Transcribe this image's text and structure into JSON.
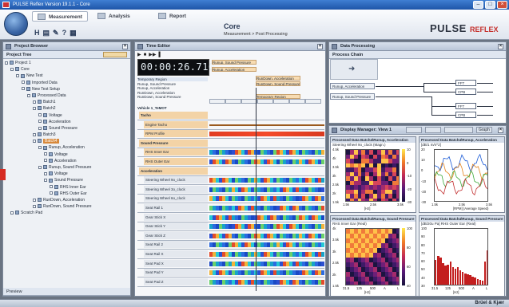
{
  "window": {
    "title": "PULSE Reflex Version 19.1.1 - Core"
  },
  "ribbon": {
    "tabs": [
      {
        "label": "Measurement",
        "active": true
      },
      {
        "label": "Analysis",
        "active": false
      },
      {
        "label": "Report",
        "active": false
      }
    ],
    "quick_access": [
      "H",
      "▤",
      "✎",
      "?",
      "▦"
    ],
    "page_title": "Core",
    "breadcrumb": "Measurement > Post Processing",
    "brand": "PULSE",
    "brand_sub": "REFLEX"
  },
  "project_browser": {
    "title": "Project Browser",
    "subtitle": "Project Tree",
    "tree": [
      {
        "label": "Project 1",
        "level": 0,
        "icon": "project-icon"
      },
      {
        "label": "Core",
        "level": 1,
        "icon": "folder-icon"
      },
      {
        "label": "New Test",
        "level": 2,
        "icon": "test-icon"
      },
      {
        "label": "Imported Data",
        "level": 3,
        "icon": "data-icon"
      },
      {
        "label": "New Test Setup",
        "level": 3,
        "icon": "setup-icon"
      },
      {
        "label": "Processed Data",
        "level": 4,
        "icon": "data-icon"
      },
      {
        "label": "Batch1",
        "level": 5,
        "icon": "batch-icon"
      },
      {
        "label": "Batch2",
        "level": 5,
        "icon": "batch-icon"
      },
      {
        "label": "Voltage",
        "level": 6,
        "icon": "signal-icon"
      },
      {
        "label": "Acceleration",
        "level": 6,
        "icon": "signal-icon"
      },
      {
        "label": "Sound Pressure",
        "level": 6,
        "icon": "signal-icon"
      },
      {
        "label": "Batch3",
        "level": 5,
        "icon": "batch-icon"
      },
      {
        "label": "Batch4",
        "level": 5,
        "icon": "batch-icon",
        "highlighted": true
      },
      {
        "label": "Runup, Acceleration",
        "level": 6,
        "icon": "signal-icon"
      },
      {
        "label": "Voltage",
        "level": 7,
        "icon": "signal-icon"
      },
      {
        "label": "Acceleration",
        "level": 7,
        "icon": "signal-icon"
      },
      {
        "label": "Runup, Sound Pressure",
        "level": 6,
        "icon": "signal-icon"
      },
      {
        "label": "Voltage",
        "level": 7,
        "icon": "signal-icon"
      },
      {
        "label": "Sound Pressure",
        "level": 7,
        "icon": "signal-icon"
      },
      {
        "label": "RHS Inner Ear",
        "level": 8,
        "icon": "signal-icon"
      },
      {
        "label": "RHS Outer Ear",
        "level": 8,
        "icon": "signal-icon"
      },
      {
        "label": "RunDown, Acceleration",
        "level": 5,
        "icon": "signal-icon"
      },
      {
        "label": "RunDown, Sound Pressure",
        "level": 5,
        "icon": "signal-icon"
      },
      {
        "label": "Scratch Pad",
        "level": 1,
        "icon": "pad-icon"
      }
    ],
    "preview_label": "Preview"
  },
  "time_editor": {
    "title": "Time Editor",
    "timer": "00:00:26.710",
    "recordings": [
      "Temporary Region",
      "Runup, Sound Pressure",
      "Runup, Acceleration",
      "RunDown, Acceleration",
      "RunDown, Sound Pressure"
    ],
    "tags": [
      "Runup, Sound Pressure",
      "Runup, Acceleration",
      "RunDown, Acceleration",
      "RunDown, Sound Pressure",
      "Temporary Region"
    ],
    "recording_name": "Vehicle 1_TeMOT",
    "channels": [
      "Tacho",
      "Engine Tacho",
      "RPM Profile",
      "Sound Pressure",
      "RHS Inner Ear",
      "RHS Outer Ear",
      "Acceleration",
      "Steering Wheel 9o_clock",
      "Steering Wheel 3o_clock",
      "Steering Wheel 6o_clock",
      "Seat Rail 1",
      "Gear Stick X",
      "Gear Stick Y",
      "Gear Stick Z",
      "Seat Rail 2",
      "Seat Rail X",
      "Seat Pad X",
      "Seat Pad Y",
      "Seat Pad Z"
    ]
  },
  "data_processing": {
    "title": "Data Processing",
    "process_chain_label": "Process Chain",
    "inputs": [
      "Runup, Acceleration",
      "Runup, Sound Pressure"
    ],
    "nodes": [
      "FFT",
      "CPB",
      "FFT",
      "CPB"
    ]
  },
  "display_manager": {
    "title": "Display Manager: View 1",
    "graph_btn": "Graph",
    "charts": [
      {
        "title": "Processed Data Batch4\\Runup, Acceleration",
        "subtitle": "Steering Wheel 9o_clock (Magn.)",
        "yunit": "[dB/1 m/s^2]",
        "x_label": "[Hz]",
        "x_ticks": [
          "1.5k",
          "2.5k",
          "3.5k"
        ]
      },
      {
        "title": "Processed Data Batch4\\Runup, Acceleration",
        "subtitle": "[dB/1 m/s^2]",
        "yunit": "",
        "x_label": "[RPM] (Average Speed)",
        "x_ticks": [
          "1.5k",
          "2.5k",
          "3.5k"
        ]
      },
      {
        "title": "Processed Data Batch4\\Runup, Sound Pressure",
        "subtitle": "RHS Inner Ear (Real)",
        "yunit": "[dB/20u Pa]",
        "x_label": "[Hz]",
        "x_ticks": [
          "31.5",
          "125",
          "500",
          "A",
          "L"
        ]
      },
      {
        "title": "Processed Data Batch4\\Runup, Sound Pressure",
        "subtitle": "[dB/20u Pa] RHS Outer Ear (Real)",
        "yunit": "",
        "x_label": "[Hz]",
        "x_ticks": [
          "31.5",
          "125",
          "500",
          "A",
          "L"
        ]
      }
    ]
  },
  "status_bar": {
    "company": "Brüel & Kjær"
  },
  "chart_data": [
    {
      "type": "heatmap",
      "title": "Processed Data Batch4\\Runup, Acceleration",
      "subtitle": "Steering Wheel 9o_clock (Magn.)",
      "ylabel": "[RPM] (Average Speed)",
      "xlabel": "[Hz]",
      "colorbar_label": "[dB/1 m/s^2]",
      "y_ticks": [
        "4.5k",
        "4k",
        "3.5k",
        "3k",
        "2.5k",
        "2k",
        "1.5k"
      ],
      "colorbar_ticks": [
        "10",
        "0",
        "-10",
        "-20",
        "-30"
      ]
    },
    {
      "type": "line",
      "title": "Processed Data Batch4\\Runup, Acceleration",
      "ylabel": "[dB/1 m/s^2]",
      "xlabel": "[RPM] (Average Speed)",
      "y_ticks": [
        "20",
        "10",
        "0",
        "-10",
        "-20",
        "-30"
      ],
      "x_ticks": [
        "1.5k",
        "2.5k",
        "3.5k"
      ]
    },
    {
      "type": "heatmap",
      "title": "Processed Data Batch4\\Runup, Sound Pressure",
      "subtitle": "RHS Inner Ear (Real)",
      "xlabel": "[Hz]",
      "colorbar_label": "[dB/20u Pa]",
      "y_ticks": [
        "4k",
        "3.5k",
        "3k",
        "2.5k",
        "2k",
        "1.5k"
      ],
      "colorbar_ticks": [
        "100",
        "80",
        "60",
        "40"
      ]
    },
    {
      "type": "bar",
      "title": "Processed Data Batch4\\Runup, Sound Pressure",
      "subtitle": "RHS Outer Ear (Real)",
      "ylabel": "[dB/20u Pa]",
      "xlabel": "[Hz]",
      "y_ticks": [
        "100",
        "90",
        "80",
        "70",
        "60",
        "50",
        "40",
        "30"
      ],
      "values": [
        55,
        60,
        58,
        50,
        47,
        48,
        52,
        45,
        42,
        44,
        40,
        38,
        36,
        34,
        33,
        31,
        30,
        28,
        27,
        26,
        52,
        68
      ]
    }
  ]
}
